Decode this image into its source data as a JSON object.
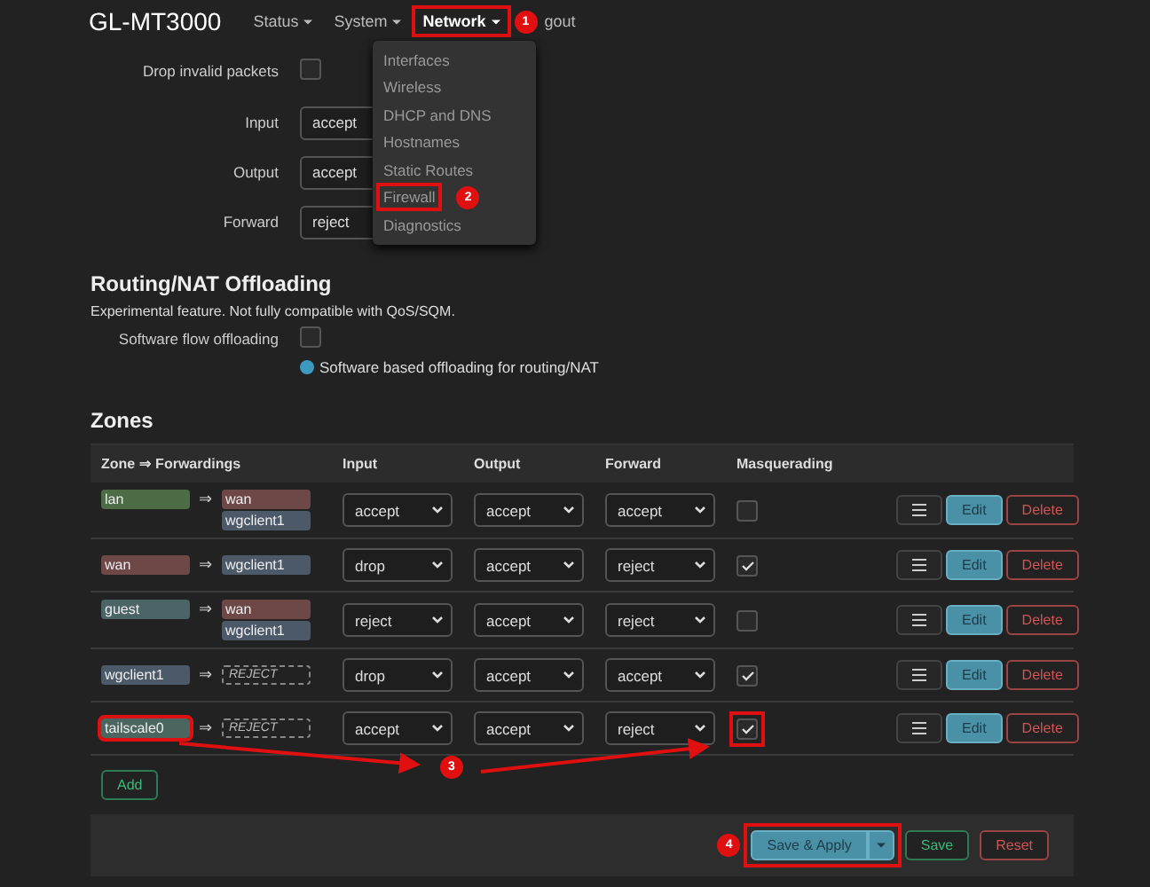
{
  "header": {
    "brand": "GL-MT3000",
    "nav": [
      {
        "label": "Status",
        "caret": true,
        "selected": false,
        "highlighted": false
      },
      {
        "label": "System",
        "caret": true,
        "selected": false,
        "highlighted": false
      },
      {
        "label": "Network",
        "caret": true,
        "selected": true,
        "highlighted": true,
        "badge": "1"
      },
      {
        "label": "gout",
        "caret": false,
        "selected": false,
        "highlighted": false
      }
    ]
  },
  "network_menu": [
    {
      "label": "Interfaces",
      "highlighted": false
    },
    {
      "label": "Wireless",
      "highlighted": false
    },
    {
      "label": "DHCP and DNS",
      "highlighted": false
    },
    {
      "label": "Hostnames",
      "highlighted": false
    },
    {
      "label": "Static Routes",
      "highlighted": false
    },
    {
      "label": "Firewall",
      "highlighted": true,
      "badge": "2"
    },
    {
      "label": "Diagnostics",
      "highlighted": false
    }
  ],
  "general": [
    {
      "kind": "checkbox",
      "label": "Drop invalid packets",
      "checked": false
    },
    {
      "kind": "select",
      "label": "Input",
      "value": "accept"
    },
    {
      "kind": "select",
      "label": "Output",
      "value": "accept"
    },
    {
      "kind": "select",
      "label": "Forward",
      "value": "reject"
    }
  ],
  "offloading": {
    "title": "Routing/NAT Offloading",
    "note": "Experimental feature. Not fully compatible with QoS/SQM.",
    "label": "Software flow offloading",
    "checked": false,
    "help": "Software based offloading for routing/NAT"
  },
  "zones": {
    "title": "Zones",
    "columns": [
      "Zone ⇒ Forwardings",
      "Input",
      "Output",
      "Forward",
      "Masquerading"
    ],
    "rows": [
      {
        "zone": {
          "name": "lan",
          "color": "#4d6b45"
        },
        "arrow": "⇒",
        "forwardings": [
          {
            "name": "wan",
            "color": "#6e4747"
          },
          {
            "name": "wgclient1",
            "color": "#4b5968"
          }
        ],
        "input": "accept",
        "output": "accept",
        "forward": "accept",
        "masquerading": false,
        "zone_highlighted": false,
        "masq_highlighted": false
      },
      {
        "zone": {
          "name": "wan",
          "color": "#6e4747"
        },
        "arrow": "⇒",
        "forwardings": [
          {
            "name": "wgclient1",
            "color": "#4b5968"
          }
        ],
        "input": "drop",
        "output": "accept",
        "forward": "reject",
        "masquerading": true,
        "zone_highlighted": false,
        "masq_highlighted": false
      },
      {
        "zone": {
          "name": "guest",
          "color": "#4b6466"
        },
        "arrow": "⇒",
        "forwardings": [
          {
            "name": "wan",
            "color": "#6e4747"
          },
          {
            "name": "wgclient1",
            "color": "#4b5968"
          }
        ],
        "input": "reject",
        "output": "accept",
        "forward": "reject",
        "masquerading": false,
        "zone_highlighted": false,
        "masq_highlighted": false
      },
      {
        "zone": {
          "name": "wgclient1",
          "color": "#4b5968"
        },
        "arrow": "⇒",
        "reject": "REJECT",
        "input": "drop",
        "output": "accept",
        "forward": "accept",
        "masquerading": true,
        "zone_highlighted": false,
        "masq_highlighted": false
      },
      {
        "zone": {
          "name": "tailscale0",
          "color": "#4b6660"
        },
        "arrow": "⇒",
        "reject": "REJECT",
        "input": "accept",
        "output": "accept",
        "forward": "reject",
        "masquerading": true,
        "zone_highlighted": true,
        "masq_highlighted": true,
        "arrow_badge": "3"
      }
    ],
    "row_buttons": [
      {
        "edit": "Edit",
        "delete": "Delete"
      },
      {
        "edit": "Edit",
        "delete": "Delete"
      },
      {
        "edit": "Edit",
        "delete": "Delete"
      },
      {
        "edit": "Edit",
        "delete": "Delete"
      },
      {
        "edit": "Edit",
        "delete": "Delete"
      }
    ],
    "add": "Add"
  },
  "footer": {
    "save_apply": {
      "label": "Save & Apply",
      "highlighted": true,
      "badge": "4"
    },
    "save": "Save",
    "reset": "Reset"
  }
}
